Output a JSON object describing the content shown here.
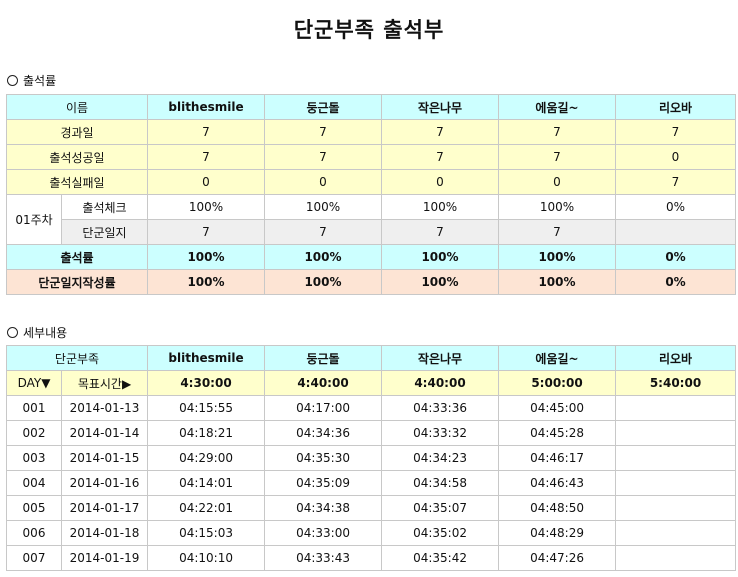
{
  "title": "단군부족 출석부",
  "section1": "출석률",
  "section2": "세부내용",
  "members": [
    "blithesmile",
    "둥근돌",
    "작은나무",
    "에움길~",
    "리오바"
  ],
  "summary": {
    "name_header": "이름",
    "days_label": "경과일",
    "days": [
      "7",
      "7",
      "7",
      "7",
      "7"
    ],
    "success_label": "출석성공일",
    "success": [
      "7",
      "7",
      "7",
      "7",
      "0"
    ],
    "fail_label": "출석실패일",
    "fail": [
      "0",
      "0",
      "0",
      "0",
      "7"
    ],
    "week_label": "01주차",
    "check_label": "출석체크",
    "check": [
      "100%",
      "100%",
      "100%",
      "100%",
      "0%"
    ],
    "diary_label": "단군일지",
    "diary": [
      "7",
      "7",
      "7",
      "7",
      ""
    ],
    "rate_label": "출석률",
    "rate": [
      "100%",
      "100%",
      "100%",
      "100%",
      "0%"
    ],
    "diary_rate_label": "단군일지작성률",
    "diary_rate": [
      "100%",
      "100%",
      "100%",
      "100%",
      "0%"
    ]
  },
  "detail": {
    "tribe_header": "단군부족",
    "day_label": "DAY▼",
    "target_label": "목표시간▶",
    "targets": [
      "4:30:00",
      "4:40:00",
      "4:40:00",
      "5:00:00",
      "5:40:00"
    ],
    "rows": [
      {
        "day": "001",
        "date": "2014-01-13",
        "times": [
          "04:15:55",
          "04:17:00",
          "04:33:36",
          "04:45:00",
          ""
        ]
      },
      {
        "day": "002",
        "date": "2014-01-14",
        "times": [
          "04:18:21",
          "04:34:36",
          "04:33:32",
          "04:45:28",
          ""
        ]
      },
      {
        "day": "003",
        "date": "2014-01-15",
        "times": [
          "04:29:00",
          "04:35:30",
          "04:34:23",
          "04:46:17",
          ""
        ]
      },
      {
        "day": "004",
        "date": "2014-01-16",
        "times": [
          "04:14:01",
          "04:35:09",
          "04:34:58",
          "04:46:43",
          ""
        ]
      },
      {
        "day": "005",
        "date": "2014-01-17",
        "times": [
          "04:22:01",
          "04:34:38",
          "04:35:07",
          "04:48:50",
          ""
        ]
      },
      {
        "day": "006",
        "date": "2014-01-18",
        "times": [
          "04:15:03",
          "04:33:00",
          "04:35:02",
          "04:48:29",
          ""
        ]
      },
      {
        "day": "007",
        "date": "2014-01-19",
        "times": [
          "04:10:10",
          "04:33:43",
          "04:35:42",
          "04:47:26",
          ""
        ]
      }
    ]
  }
}
